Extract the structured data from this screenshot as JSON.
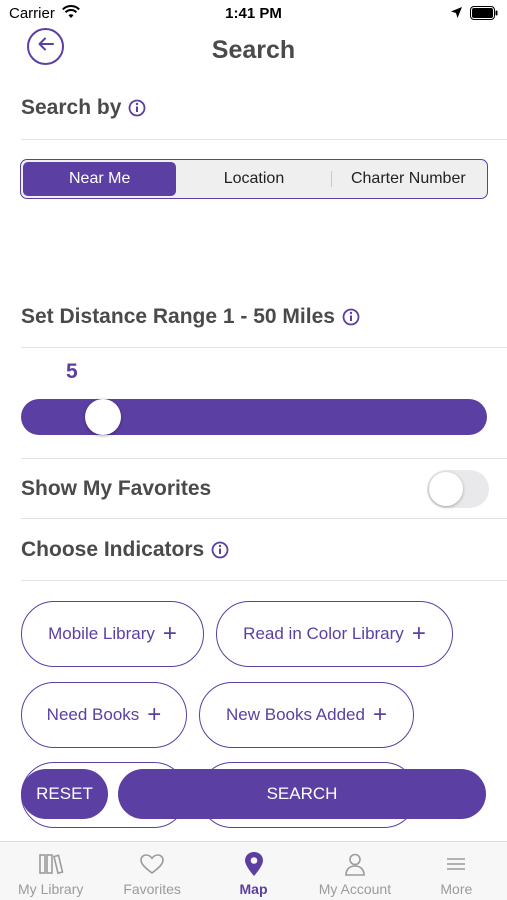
{
  "status_bar": {
    "carrier": "Carrier",
    "time": "1:41 PM"
  },
  "header": {
    "title": "Search"
  },
  "search_by": {
    "title": "Search by",
    "segments": [
      "Near Me",
      "Location",
      "Charter Number"
    ],
    "selected": "Near Me"
  },
  "distance": {
    "title": "Set Distance Range 1 - 50 Miles",
    "value": "5",
    "min": 1,
    "max": 50
  },
  "favorites": {
    "label": "Show My Favorites",
    "enabled": false
  },
  "indicators": {
    "title": "Choose Indicators",
    "chips": [
      "Mobile Library",
      "Read in Color Library",
      "Need Books",
      "New Books Added"
    ],
    "plus": "+"
  },
  "actions": {
    "reset": "RESET",
    "search": "SEARCH"
  },
  "tabs": [
    {
      "label": "My Library",
      "icon": "books-icon"
    },
    {
      "label": "Favorites",
      "icon": "heart-icon"
    },
    {
      "label": "Map",
      "icon": "map-pin-icon",
      "active": true
    },
    {
      "label": "My Account",
      "icon": "person-icon"
    },
    {
      "label": "More",
      "icon": "menu-icon"
    }
  ],
  "colors": {
    "accent": "#5b3fa3",
    "inactive": "#9b9b9b"
  }
}
